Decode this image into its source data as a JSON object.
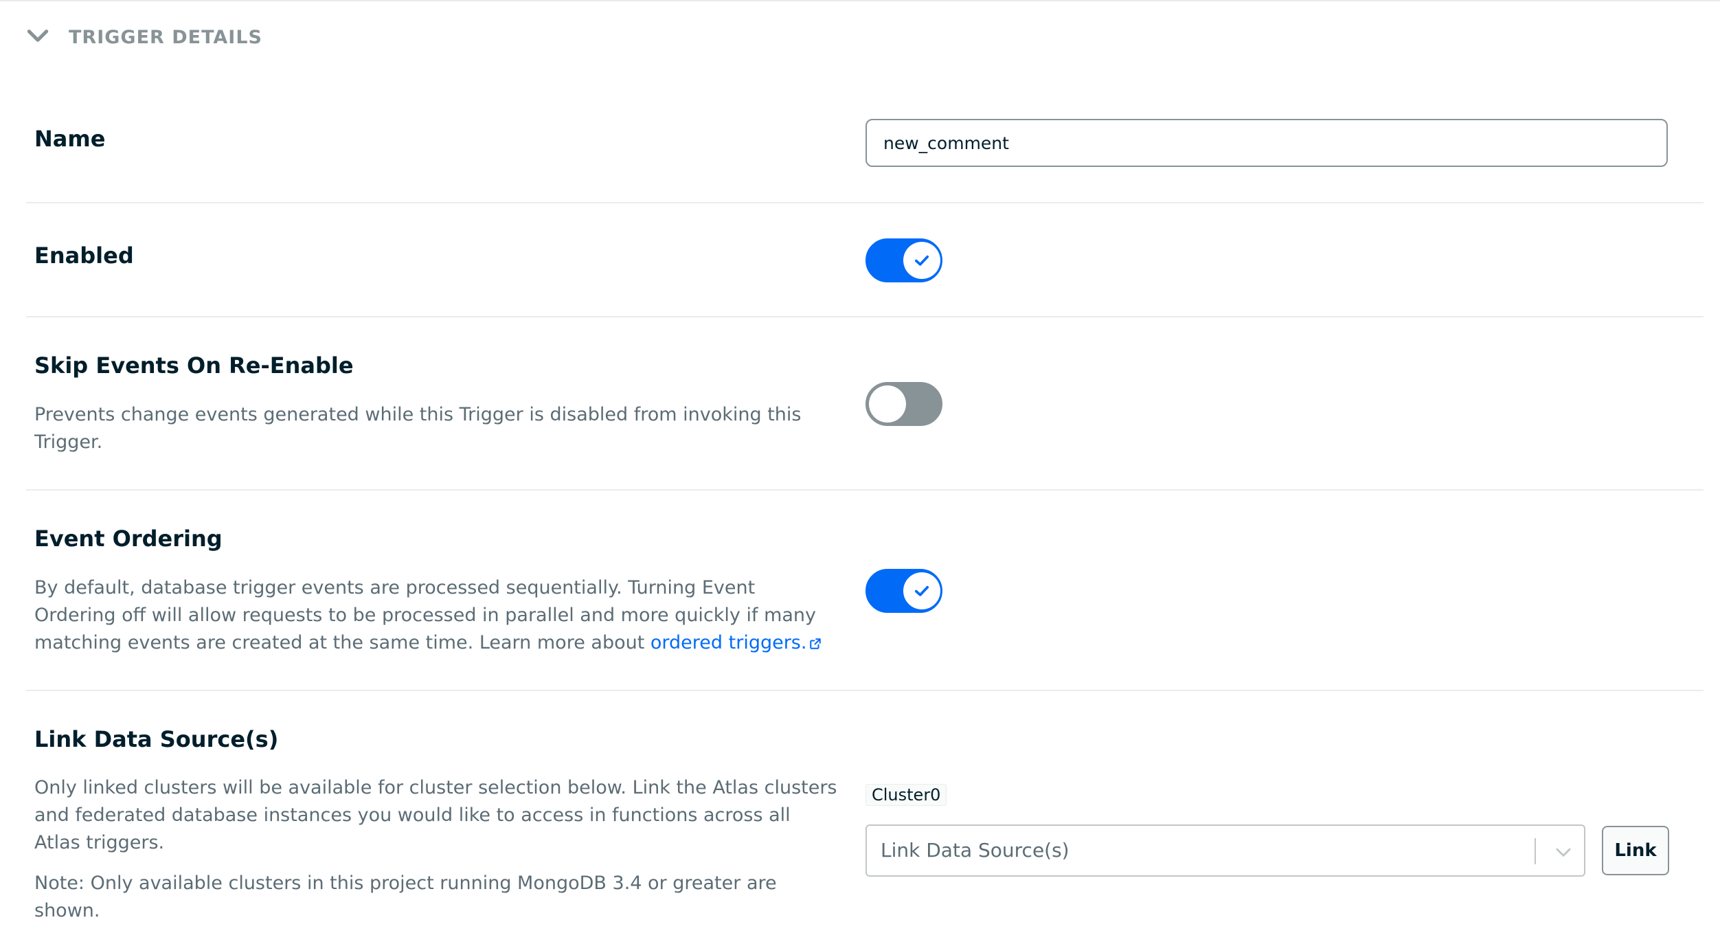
{
  "section": {
    "title": "TRIGGER DETAILS",
    "icon": "chevron-down-icon"
  },
  "name_row": {
    "label": "Name",
    "value": "new_comment"
  },
  "enabled_row": {
    "label": "Enabled",
    "state": "on"
  },
  "skip_events_row": {
    "label": "Skip Events On Re-Enable",
    "description_line1": "Prevents change events generated while this Trigger is disabled from invoking this",
    "description_line2": "Trigger.",
    "state": "off"
  },
  "event_ordering_row": {
    "label": "Event Ordering",
    "description_line1": "By default, database trigger events are processed sequentially. Turning Event",
    "description_line2": "Ordering off will allow requests to be processed in parallel and more quickly if many",
    "description_line3": "matching events are created at the same time. Learn more about ",
    "link_text": "ordered triggers.",
    "state": "on"
  },
  "link_data_source_row": {
    "label": "Link Data Source(s)",
    "description_line1": "Only linked clusters will be available for cluster selection below. Link the Atlas clusters",
    "description_line2": "and federated database instances you would like to access in functions across all",
    "description_line3": "Atlas triggers.",
    "note_line1": "Note: Only available clusters in this project running MongoDB 3.4 or greater are",
    "note_line2": "shown.",
    "linked_cluster": "Cluster0",
    "select_placeholder": "Link Data Source(s)",
    "button_label": "Link"
  },
  "colors": {
    "accent": "#016bf8",
    "toggle_off": "#889397",
    "text_muted": "#5c6c75",
    "divider": "#e8edeb"
  }
}
